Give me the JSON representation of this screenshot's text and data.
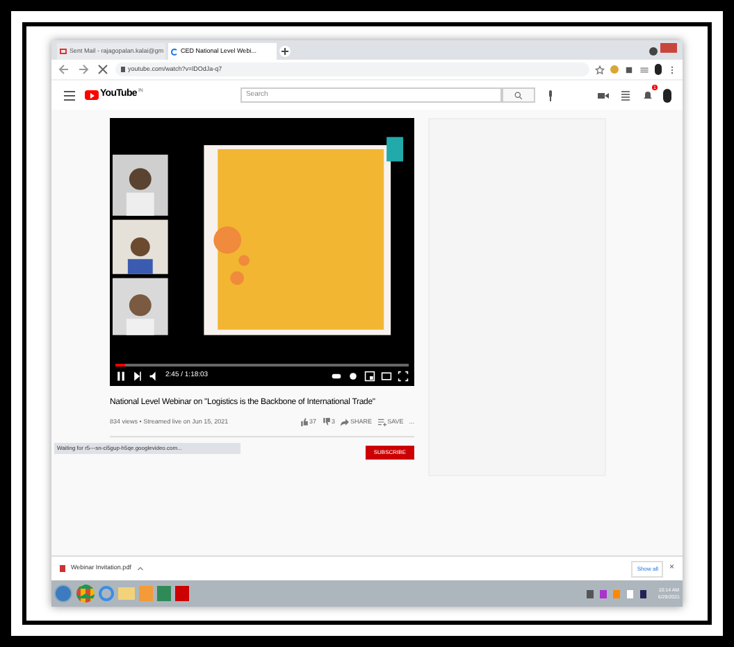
{
  "browser": {
    "tabs": [
      {
        "label": "Sent Mail - rajagopalan.kalai@gm",
        "selected": false,
        "kind": "mail"
      },
      {
        "label": "CED National Level Webi...",
        "selected": true,
        "kind": "loading"
      }
    ],
    "url": "youtube.com/watch?v=lDOdJa-q7"
  },
  "youtube": {
    "logo": "YouTube",
    "region": "IN",
    "search": {
      "placeholder": "Search"
    },
    "notifications": "1"
  },
  "player": {
    "progress": {
      "level": 0.035
    },
    "time": "2:45 / 1:18:03"
  },
  "video": {
    "title": "National Level Webinar on \"Logistics is the Backbone of International Trade\"",
    "meta": "834 views • Streamed live on Jun 15, 2021",
    "likes": "37",
    "dislikes": "3",
    "share": "SHARE",
    "save": "SAVE",
    "more": "..."
  },
  "subscribe": "SUBSCRIBE",
  "status_bar": "Waiting for r5---sn-ci5gup-h5qe.googlevideo.com...",
  "download": {
    "file": "Webinar Invitation.pdf",
    "show_all": "Show all",
    "close": "×"
  },
  "taskbar": {
    "time": "10:14 AM",
    "date": "6/29/2021"
  }
}
